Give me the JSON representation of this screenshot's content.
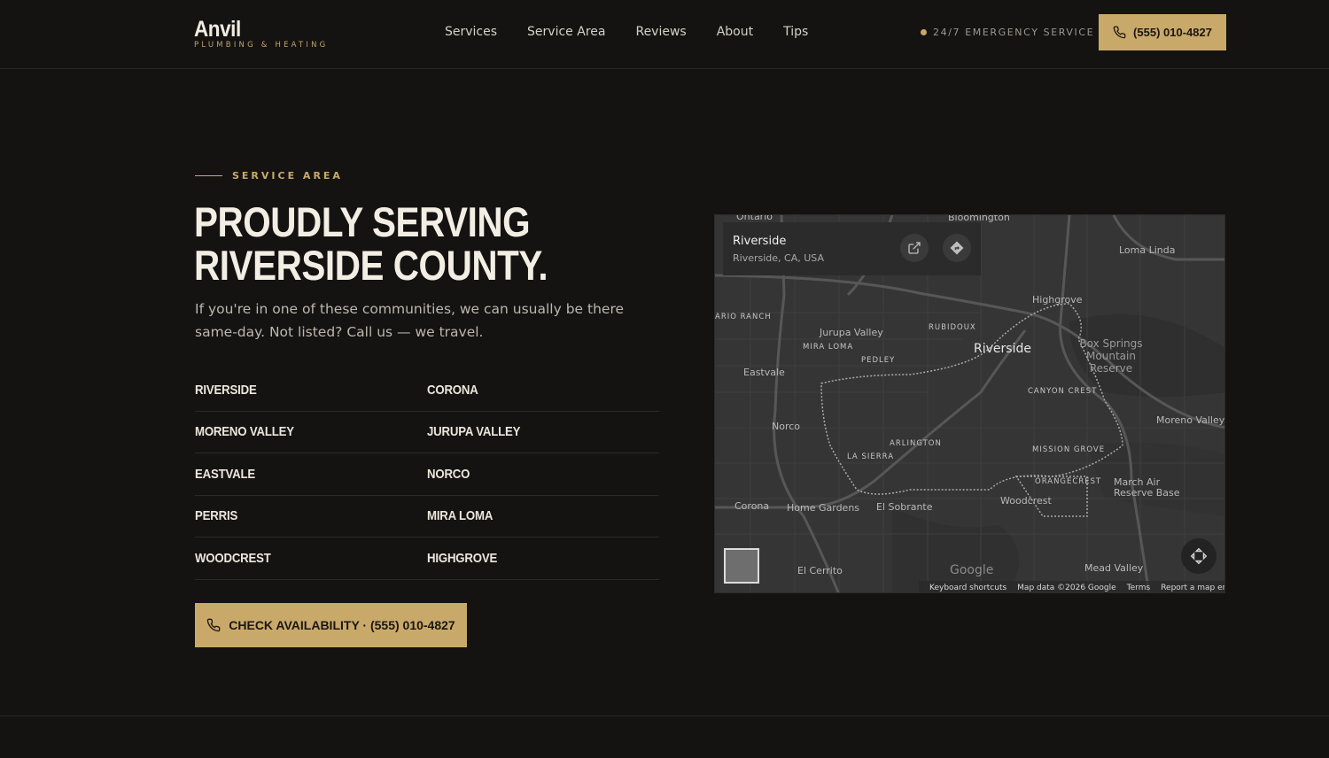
{
  "brand": {
    "name": "Anvil",
    "tagline": "PLUMBING & HEATING"
  },
  "nav": [
    {
      "label": "Services"
    },
    {
      "label": "Service Area"
    },
    {
      "label": "Reviews"
    },
    {
      "label": "About"
    },
    {
      "label": "Tips"
    }
  ],
  "header": {
    "emergency_text": "24/7 EMERGENCY SERVICE",
    "phone": "(555) 010-4827"
  },
  "section": {
    "eyebrow": "SERVICE AREA",
    "headline_line1": "PROUDLY SERVING",
    "headline_line2": "RIVERSIDE COUNTY.",
    "intro": "If you're in one of these communities, we can usually be there same-day. Not listed? Call us — we travel.",
    "areas": [
      [
        "RIVERSIDE",
        "CORONA"
      ],
      [
        "MORENO VALLEY",
        "JURUPA VALLEY"
      ],
      [
        "EASTVALE",
        "NORCO"
      ],
      [
        "PERRIS",
        "MIRA LOMA"
      ],
      [
        "WOODCREST",
        "HIGHGROVE"
      ]
    ],
    "cta_label": "CHECK AVAILABILITY · (555) 010-4827"
  },
  "map": {
    "place_title": "Riverside",
    "place_subtitle": "Riverside, CA, USA",
    "labels": {
      "ontario": "Ontario",
      "bloomington": "Bloomington",
      "loma_linda": "Loma Linda",
      "highgrove": "Highgrove",
      "ario_ranch": "ARIO RANCH",
      "jurupa_valley": "Jurupa Valley",
      "mira_loma": "MIRA LOMA",
      "rubidoux": "RUBIDOUX",
      "riverside": "Riverside",
      "box_springs": "Box Springs Mountain Reserve",
      "pedley": "PEDLEY",
      "eastvale": "Eastvale",
      "canyon_crest": "CANYON CREST",
      "moreno_valley": "Moreno Valley",
      "norco": "Norco",
      "arlington": "ARLINGTON",
      "la_sierra": "LA SIERRA",
      "mission_grove": "MISSION GROVE",
      "orangecrest": "ORANGECREST",
      "march_air": "March Air Reserve Base",
      "corona": "Corona",
      "home_gardens": "Home Gardens",
      "el_sobrante": "El Sobrante",
      "woodcrest": "Woodcrest",
      "el_cerrito": "El Cerrito",
      "mead_valley": "Mead Valley"
    },
    "google_logo": "Google",
    "attribution": [
      "Keyboard shortcuts",
      "Map data ©2026 Google",
      "Terms",
      "Report a map error"
    ]
  },
  "colors": {
    "accent": "#c9a96a",
    "background": "#141312",
    "text": "#f3eee4"
  }
}
